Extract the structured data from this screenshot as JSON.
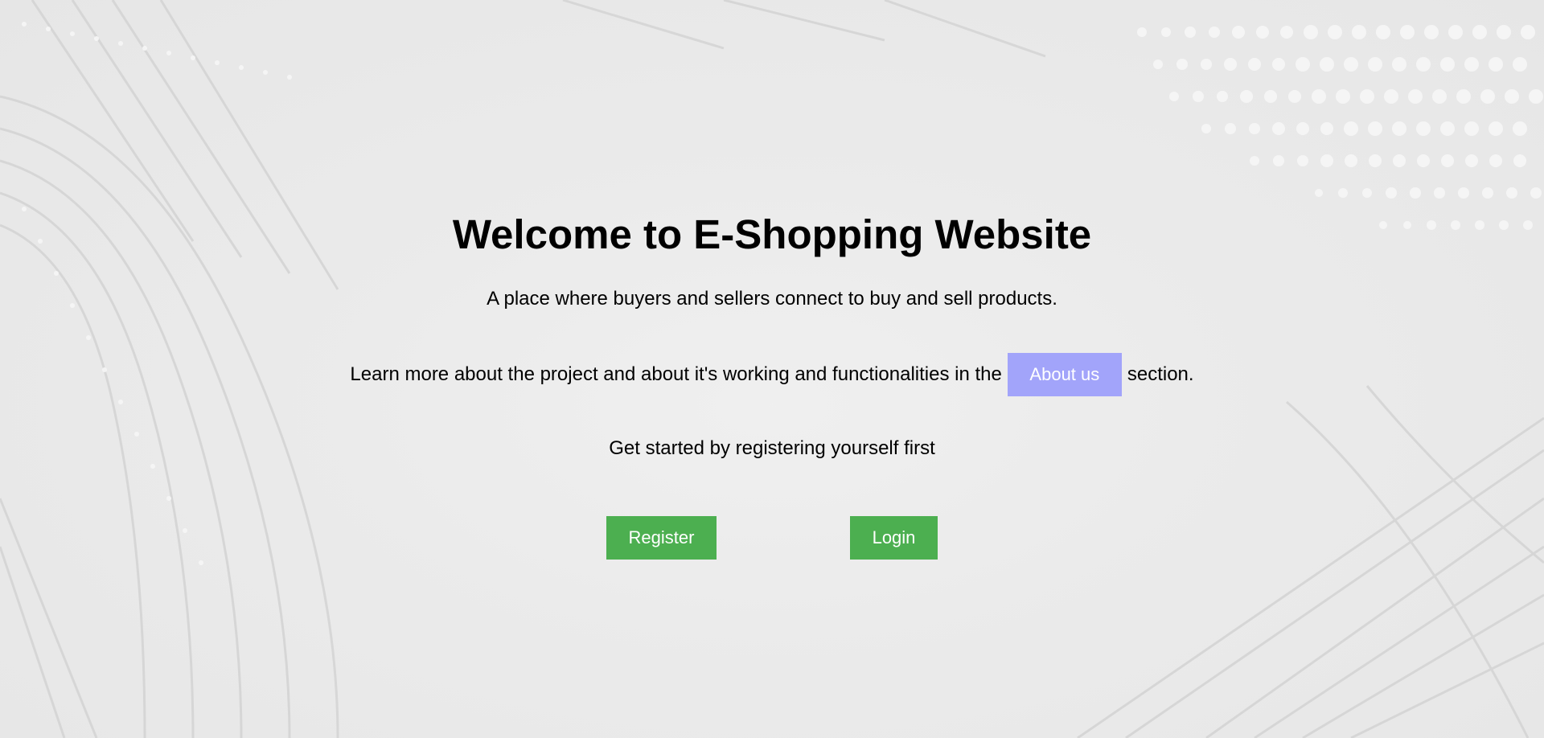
{
  "hero": {
    "title": "Welcome to E-Shopping Website",
    "tagline": "A place where buyers and sellers connect to buy and sell products.",
    "learn_prefix": "Learn more about the project and about it's working and functionalities in the",
    "about_label": "About us",
    "learn_suffix": "section.",
    "get_started": "Get started by registering yourself first"
  },
  "actions": {
    "register_label": "Register",
    "login_label": "Login"
  },
  "colors": {
    "about_button": "#a2a4fa",
    "action_button": "#4caf50",
    "background": "#e9e9e9"
  }
}
